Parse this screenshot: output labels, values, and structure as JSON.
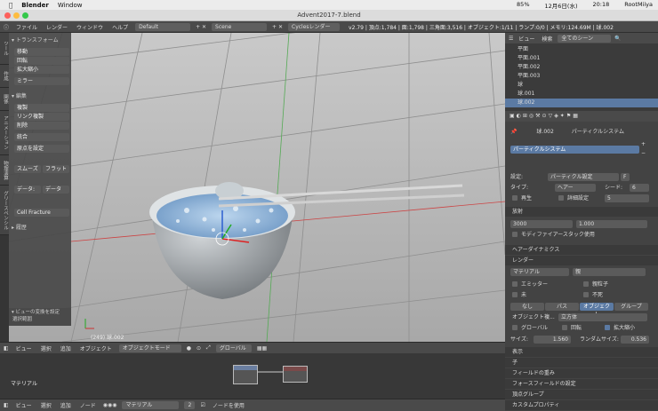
{
  "mac": {
    "app": "Blender",
    "menu": "Window",
    "battery": "85%",
    "date": "12月6日(水)",
    "time": "20:18",
    "user": "RootMiiya"
  },
  "window": {
    "title": "Advent2017-7.blend"
  },
  "bheader": {
    "menus": [
      "ファイル",
      "レンダー",
      "ウィンドウ",
      "ヘルプ"
    ],
    "layout": "Default",
    "scene": "Scene",
    "engine": "Cyclesレンダー",
    "stats": "v2.79 | 頂点:1,784 | 面:1,798 | 三角面:3,516 | オブジェクト:1/11 | ランプ:0/0 | メモリ:124.69M | 球.002"
  },
  "toolshelf": {
    "sec_transform": "▾ トランスフォーム",
    "move": "移動",
    "rotate": "回転",
    "scale": "拡大縮小",
    "mirror": "ミラー",
    "sec_edit": "▾ 編集",
    "duplicate": "複製",
    "link_dup": "リンク複製",
    "delete": "削除",
    "join": "統合",
    "origin": "原点を設定",
    "smooth": "スムーズ",
    "flat": "フラット",
    "data_label": "データ:",
    "data2": "データ",
    "cell": "Cell Fracture",
    "history": "▸ 履歴",
    "operator_title": "▾ ビューの変換を設定",
    "operator_option": "選択範囲"
  },
  "lefttabs": [
    "ツール",
    "作成",
    "関係",
    "アニメーション",
    "物理演算",
    "グリースペンシル"
  ],
  "viewport": {
    "object_label": "(249) 球.002"
  },
  "v3dheader": {
    "view": "ビュー",
    "select": "選択",
    "add": "追加",
    "object": "オブジェクト",
    "mode": "オブジェクトモード",
    "orientation": "グローバル"
  },
  "nodeeditor": {
    "material": "マテリアル"
  },
  "nodeheader": {
    "view": "ビュー",
    "select": "選択",
    "add": "追加",
    "node": "ノード",
    "material": "マテリアル",
    "users": "2",
    "use_nodes": "ノードを使用"
  },
  "outliner": {
    "view": "ビュー",
    "search": "検索",
    "scope": "全てのシーン",
    "rows": [
      {
        "name": "平面"
      },
      {
        "name": "平面.001"
      },
      {
        "name": "平面.002"
      },
      {
        "name": "平面.003"
      },
      {
        "name": "球"
      },
      {
        "name": "球.001"
      },
      {
        "name": "球.002",
        "selected": true
      }
    ]
  },
  "props": {
    "object": "球.002",
    "context": "パーティクルシステム",
    "system_name": "パーティクルシステム",
    "settings_label": "設定:",
    "settings_value": "パーティクル設定",
    "settings_users": "F",
    "type_label": "タイプ:",
    "type_value": "ヘアー",
    "seed_label": "シード:",
    "seed_value": "6",
    "regrow": "再生",
    "advanced": "詳細設定",
    "segments_label": "セグメント:",
    "segments_value": "5",
    "emission_head": "放射",
    "number_label": "数:",
    "number_value": "3000",
    "hair_length_label": "ヘアー長:",
    "hair_length_value": "1.000",
    "modifier_stack": "モディファイアースタック使用",
    "hair_dynamics": "ヘアーダイナミクス",
    "render_head": "レンダー",
    "material_label": "マテリアル",
    "parent_label": "親",
    "emitter": "エミッター",
    "parents": "親粒子",
    "unborn": "未",
    "died": "不死",
    "none_tab": "なし",
    "path_tab": "パス",
    "object_tab": "オブジェクト",
    "group_tab": "グループ",
    "dupli_object_label": "オブジェクト複...",
    "dupli_object_value": "立方体",
    "global": "グローバル",
    "rotation": "回転",
    "scale": "拡大縮小",
    "size_label": "サイズ:",
    "size_value": "1.560",
    "random_size_label": "ランダムサイズ:",
    "random_size_value": "0.536",
    "panels": [
      "表示",
      "子",
      "フィールドの重み",
      "フォースフィールドの設定",
      "頂点グループ",
      "カスタムプロパティ"
    ]
  }
}
